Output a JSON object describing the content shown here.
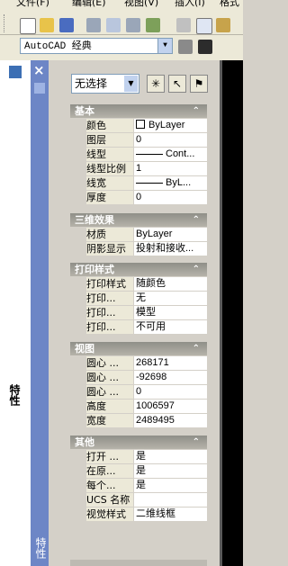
{
  "menubar": {
    "items": [
      "文件(F)",
      "编辑(E)",
      "视图(V)",
      "插入(I)",
      "格式"
    ]
  },
  "workspace": {
    "value": "AutoCAD 经典"
  },
  "palette": {
    "title": "特性",
    "side_label": "特性",
    "close": "×"
  },
  "selection": {
    "value": "无选择"
  },
  "groups": [
    {
      "title": "基本",
      "rows": [
        {
          "label": "颜色",
          "value": "ByLayer",
          "kind": "color"
        },
        {
          "label": "图层",
          "value": "0"
        },
        {
          "label": "线型",
          "value": "Cont...",
          "kind": "line"
        },
        {
          "label": "线型比例",
          "value": "1"
        },
        {
          "label": "线宽",
          "value": "ByL...",
          "kind": "line"
        },
        {
          "label": "厚度",
          "value": "0"
        }
      ]
    },
    {
      "title": "三维效果",
      "rows": [
        {
          "label": "材质",
          "value": "ByLayer"
        },
        {
          "label": "阴影显示",
          "value": "投射和接收..."
        }
      ]
    },
    {
      "title": "打印样式",
      "rows": [
        {
          "label": "打印样式",
          "value": "随颜色"
        },
        {
          "label": "打印...",
          "value": "无"
        },
        {
          "label": "打印...",
          "value": "模型"
        },
        {
          "label": "打印...",
          "value": "不可用"
        }
      ]
    },
    {
      "title": "视图",
      "rows": [
        {
          "label": "圆心 ...",
          "value": "268171"
        },
        {
          "label": "圆心 ...",
          "value": "-92698"
        },
        {
          "label": "圆心 ...",
          "value": "0"
        },
        {
          "label": "高度",
          "value": "1006597"
        },
        {
          "label": "宽度",
          "value": "2489495"
        }
      ]
    },
    {
      "title": "其他",
      "rows": [
        {
          "label": "打开 ...",
          "value": "是"
        },
        {
          "label": "在原...",
          "value": "是"
        },
        {
          "label": "每个...",
          "value": "是"
        },
        {
          "label": "UCS 名称",
          "value": ""
        },
        {
          "label": "视觉样式",
          "value": "二维线框"
        }
      ]
    }
  ],
  "colors": {
    "header": "#9c9a92",
    "blue_bar": "#6d86c6",
    "canvas": "#000000"
  }
}
